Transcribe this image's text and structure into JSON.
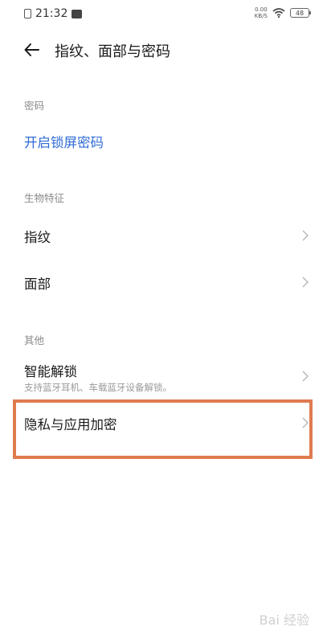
{
  "status_bar": {
    "time": "21:32",
    "net_speed_value": "0.00",
    "net_speed_unit": "KB/S",
    "battery": "48",
    "icons": [
      "sim-icon",
      "message-icon",
      "wifi-icon",
      "battery-icon"
    ]
  },
  "header": {
    "title": "指纹、面部与密码",
    "back_icon": "arrow-left-icon"
  },
  "sections": {
    "password": {
      "label": "密码",
      "items": [
        {
          "title": "开启锁屏密码"
        }
      ]
    },
    "biometrics": {
      "label": "生物特征",
      "items": [
        {
          "title": "指纹"
        },
        {
          "title": "面部"
        }
      ]
    },
    "other": {
      "label": "其他",
      "items": [
        {
          "title": "智能解锁",
          "subtitle": "支持蓝牙耳机、车载蓝牙设备解锁。"
        },
        {
          "title": "隐私与应用加密"
        }
      ]
    }
  },
  "watermark": "Bai 经验",
  "colors": {
    "accent_link": "#2f6bd6",
    "highlight": "#e07a4f",
    "section_label": "#8a8a8a"
  }
}
